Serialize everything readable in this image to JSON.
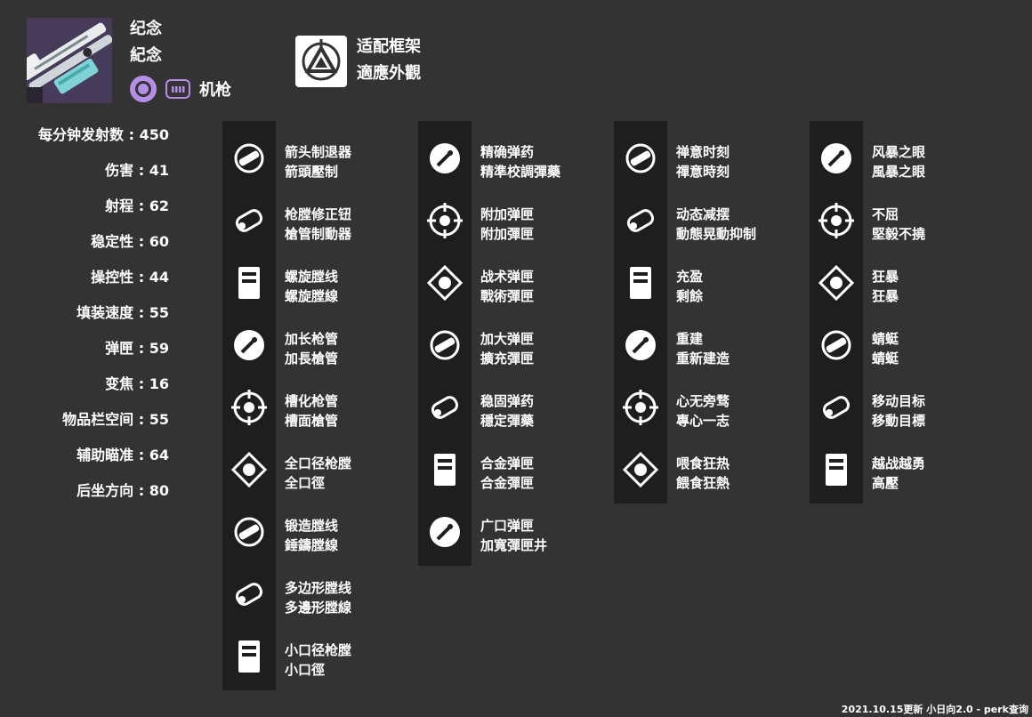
{
  "weapon": {
    "name_simplified": "纪念",
    "name_traditional": "紀念",
    "type_label": "机枪",
    "ammo_icon": "heavy-ammo-icon",
    "slot_icon": "power-slot-icon",
    "accent_color": "#b58ee6"
  },
  "frame": {
    "icon": "adaptive-frame-icon",
    "name_simplified": "适配框架",
    "name_traditional": "適應外觀"
  },
  "stats": [
    {
      "label": "每分钟发射数",
      "value": "450"
    },
    {
      "label": "伤害",
      "value": "41"
    },
    {
      "label": "射程",
      "value": "62"
    },
    {
      "label": "稳定性",
      "value": "60"
    },
    {
      "label": "操控性",
      "value": "44"
    },
    {
      "label": "填装速度",
      "value": "55"
    },
    {
      "label": "弹匣",
      "value": "59"
    },
    {
      "label": "变焦",
      "value": "16"
    },
    {
      "label": "物品栏空间",
      "value": "55"
    },
    {
      "label": "辅助瞄准",
      "value": "64"
    },
    {
      "label": "后坐方向",
      "value": "80"
    }
  ],
  "columns": [
    {
      "name": "barrels",
      "perks": [
        {
          "s": "箭头制退器",
          "t": "箭頭壓制",
          "icon": "arrowhead-brake-icon"
        },
        {
          "s": "枪膛修正钮",
          "t": "槍管制動器",
          "icon": "hammer-forged-compensator-icon"
        },
        {
          "s": "螺旋膛线",
          "t": "螺旋膛線",
          "icon": "corkscrew-rifling-icon"
        },
        {
          "s": "加长枪管",
          "t": "加長槍管",
          "icon": "extended-barrel-icon"
        },
        {
          "s": "槽化枪管",
          "t": "槽面槍管",
          "icon": "fluted-barrel-icon"
        },
        {
          "s": "全口径枪膛",
          "t": "全口徑",
          "icon": "full-bore-icon"
        },
        {
          "s": "锻造膛线",
          "t": "錘鑄膛線",
          "icon": "hammer-forged-rifling-icon"
        },
        {
          "s": "多边形膛线",
          "t": "多邊形膛線",
          "icon": "polygonal-rifling-icon"
        },
        {
          "s": "小口径枪膛",
          "t": "小口徑",
          "icon": "small-bore-icon"
        }
      ]
    },
    {
      "name": "magazines",
      "perks": [
        {
          "s": "精确弹药",
          "t": "精準校調彈藥",
          "icon": "accurized-rounds-icon"
        },
        {
          "s": "附加弹匣",
          "t": "附加彈匣",
          "icon": "appended-mag-icon"
        },
        {
          "s": "战术弹匣",
          "t": "戰術彈匣",
          "icon": "tactical-mag-icon"
        },
        {
          "s": "加大弹匣",
          "t": "擴充彈匣",
          "icon": "extended-mag-icon"
        },
        {
          "s": "稳固弹药",
          "t": "穩定彈藥",
          "icon": "steady-rounds-icon"
        },
        {
          "s": "合金弹匣",
          "t": "合金彈匣",
          "icon": "alloy-magazine-icon"
        },
        {
          "s": "广口弹匣",
          "t": "加寬彈匣井",
          "icon": "flared-magwell-icon"
        }
      ]
    },
    {
      "name": "trait-1",
      "perks": [
        {
          "s": "禅意时刻",
          "t": "禪意時刻",
          "icon": "zen-moment-icon"
        },
        {
          "s": "动态减摆",
          "t": "動態晃動抑制",
          "icon": "dynamic-sway-reduction-icon"
        },
        {
          "s": "充盈",
          "t": "剩餘",
          "icon": "surplus-icon"
        },
        {
          "s": "重建",
          "t": "重新建造",
          "icon": "rewind-rounds-icon"
        },
        {
          "s": "心无旁骛",
          "t": "專心一志",
          "icon": "eye-of-the-storm-focus-icon"
        },
        {
          "s": "喂食狂热",
          "t": "餵食狂熱",
          "icon": "feeding-frenzy-icon"
        }
      ]
    },
    {
      "name": "trait-2",
      "perks": [
        {
          "s": "风暴之眼",
          "t": "風暴之眼",
          "icon": "eye-of-the-storm-icon"
        },
        {
          "s": "不屈",
          "t": "堅毅不撓",
          "icon": "unrelenting-icon"
        },
        {
          "s": "狂暴",
          "t": "狂暴",
          "icon": "rampage-icon"
        },
        {
          "s": "蜻蜓",
          "t": "蜻蜓",
          "icon": "dragonfly-icon"
        },
        {
          "s": "移动目标",
          "t": "移動目標",
          "icon": "moving-target-icon"
        },
        {
          "s": "越战越勇",
          "t": "高壓",
          "icon": "under-pressure-icon"
        }
      ]
    }
  ],
  "footer": "2021.10.15更新 小日向2.0 - perk查询"
}
